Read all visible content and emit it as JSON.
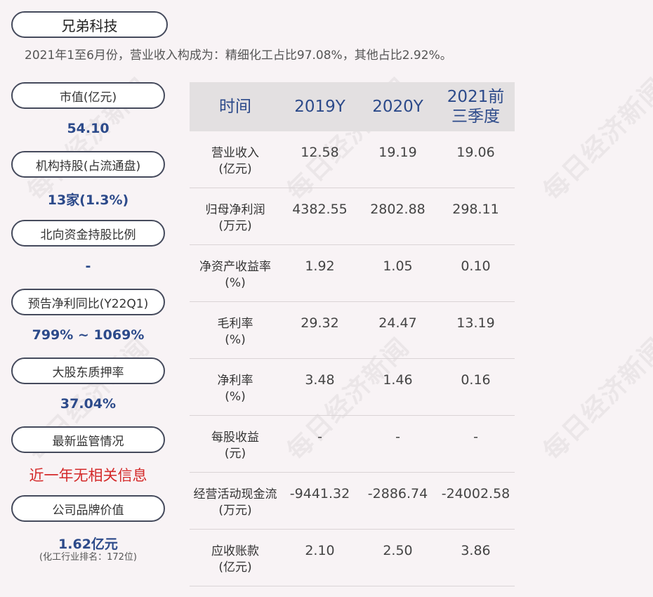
{
  "company": "兄弟科技",
  "summary": "2021年1至6月份，营业收入构成为：精细化工占比97.08%，其他占比2.92%。",
  "watermark_text": "每日经济新闻",
  "metrics": [
    {
      "label": "市值(亿元)",
      "value": "54.10"
    },
    {
      "label": "机构持股(占流通盘)",
      "value": "13家(1.3%)"
    },
    {
      "label": "北向资金持股比例",
      "value": "-"
    },
    {
      "label": "预告净利同比(Y22Q1)",
      "value": "799% ~ 1069%"
    },
    {
      "label": "大股东质押率",
      "value": "37.04%"
    },
    {
      "label": "最新监管情况",
      "value": "近一年无相关信息"
    },
    {
      "label": "公司品牌价值",
      "value": "1.62亿元",
      "note": "(化工行业排名：172位)"
    }
  ],
  "table": {
    "headers": [
      "时间",
      "2019Y",
      "2020Y",
      "2021前三季度"
    ],
    "rows": [
      {
        "label1": "营业收入",
        "label2": "(亿元)",
        "values": [
          "12.58",
          "19.19",
          "19.06"
        ]
      },
      {
        "label1": "归母净利润",
        "label2": "(万元)",
        "values": [
          "4382.55",
          "2802.88",
          "298.11"
        ]
      },
      {
        "label1": "净资产收益率",
        "label2": "(%)",
        "values": [
          "1.92",
          "1.05",
          "0.10"
        ]
      },
      {
        "label1": "毛利率",
        "label2": "(%)",
        "values": [
          "29.32",
          "24.47",
          "13.19"
        ]
      },
      {
        "label1": "净利率",
        "label2": "(%)",
        "values": [
          "3.48",
          "1.46",
          "0.16"
        ]
      },
      {
        "label1": "每股收益",
        "label2": "(元)",
        "values": [
          "-",
          "-",
          "-"
        ]
      },
      {
        "label1": "经营活动现金流",
        "label2": "(万元)",
        "values": [
          "-9441.32",
          "-2886.74",
          "-24002.58"
        ]
      },
      {
        "label1": "应收账款",
        "label2": "(亿元)",
        "values": [
          "2.10",
          "2.50",
          "3.86"
        ]
      }
    ]
  }
}
